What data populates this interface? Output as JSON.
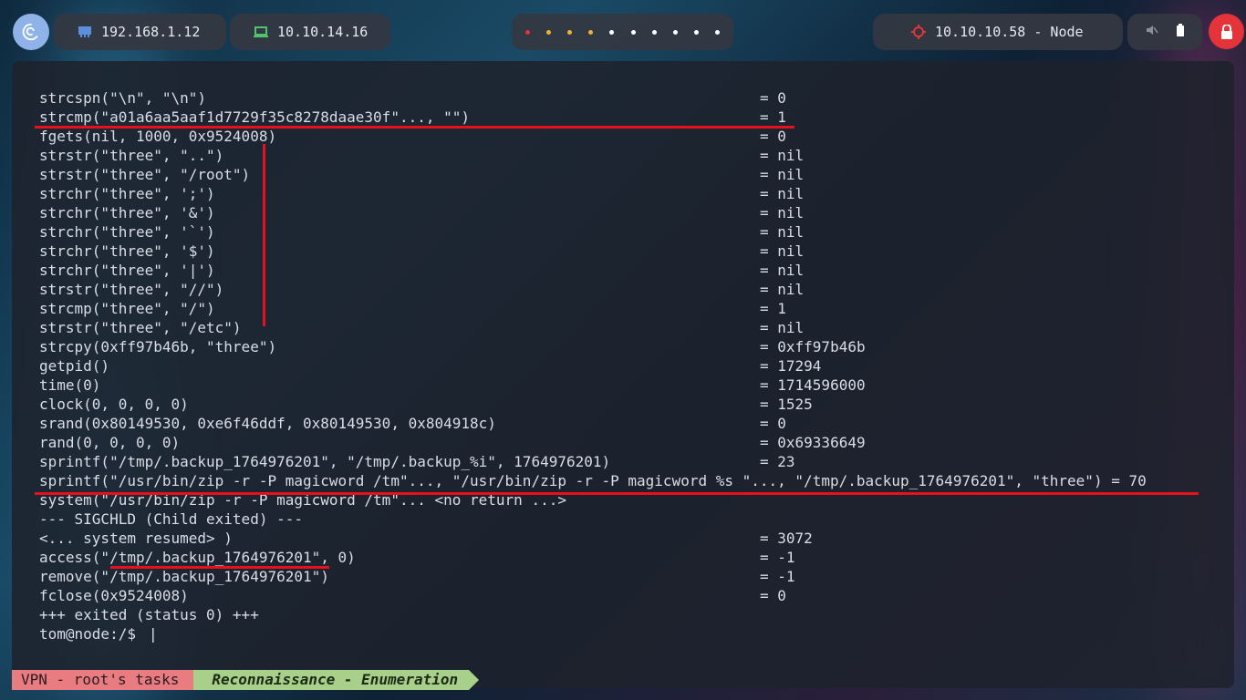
{
  "topbar": {
    "local_ip": "192.168.1.12",
    "vpn_ip": "10.10.14.16",
    "target": "10.10.10.58 - Node",
    "workspace_dots": [
      {
        "color": "#e5333a"
      },
      {
        "color": "#f0b232"
      },
      {
        "color": "#f0b232"
      },
      {
        "color": "#f0b232"
      },
      {
        "color": "#ffffff"
      },
      {
        "color": "#ffffff"
      },
      {
        "color": "#ffffff"
      },
      {
        "color": "#ffffff"
      },
      {
        "color": "#ffffff"
      },
      {
        "color": "#ffffff"
      }
    ],
    "icons": [
      "debian-logo-icon",
      "network-icon",
      "laptop-icon",
      "target-icon",
      "mute-icon",
      "battery-icon",
      "lock-icon"
    ]
  },
  "terminal": {
    "lines": [
      {
        "call": "strcspn(\"\\n\", \"\\n\")",
        "ret": "= 0"
      },
      {
        "call": "strcmp(\"a01a6aa5aaf1d7729f35c8278daae30f\"..., \"\")",
        "ret": "= 1"
      },
      {
        "call": "fgets(nil, 1000, 0x9524008)",
        "ret": "= 0"
      },
      {
        "call": "strstr(\"three\", \"..\")",
        "ret": "= nil"
      },
      {
        "call": "strstr(\"three\", \"/root\")",
        "ret": "= nil"
      },
      {
        "call": "strchr(\"three\", ';')",
        "ret": "= nil"
      },
      {
        "call": "strchr(\"three\", '&')",
        "ret": "= nil"
      },
      {
        "call": "strchr(\"three\", '`')",
        "ret": "= nil"
      },
      {
        "call": "strchr(\"three\", '$')",
        "ret": "= nil"
      },
      {
        "call": "strchr(\"three\", '|')",
        "ret": "= nil"
      },
      {
        "call": "strstr(\"three\", \"//\")",
        "ret": "= nil"
      },
      {
        "call": "strcmp(\"three\", \"/\")",
        "ret": "= 1"
      },
      {
        "call": "strstr(\"three\", \"/etc\")",
        "ret": "= nil"
      },
      {
        "call": "strcpy(0xff97b46b, \"three\")",
        "ret": "= 0xff97b46b"
      },
      {
        "call": "getpid()",
        "ret": "= 17294"
      },
      {
        "call": "time(0)",
        "ret": "= 1714596000"
      },
      {
        "call": "clock(0, 0, 0, 0)",
        "ret": "= 1525"
      },
      {
        "call": "srand(0x80149530, 0xe6f46ddf, 0x80149530, 0x804918c)",
        "ret": "= 0"
      },
      {
        "call": "rand(0, 0, 0, 0)",
        "ret": "= 0x69336649"
      },
      {
        "call": "sprintf(\"/tmp/.backup_1764976201\", \"/tmp/.backup_%i\", 1764976201)",
        "ret": "= 23"
      },
      {
        "call": "sprintf(\"/usr/bin/zip -r -P magicword /tm\"..., \"/usr/bin/zip -r -P magicword %s \"..., \"/tmp/.backup_1764976201\", \"three\") = 70",
        "ret": ""
      },
      {
        "call": "system(\"/usr/bin/zip -r -P magicword /tm\"... <no return ...>",
        "ret": ""
      },
      {
        "call": "--- SIGCHLD (Child exited) ---",
        "ret": ""
      },
      {
        "call": "<... system resumed> )",
        "ret": "= 3072"
      },
      {
        "call": "access(\"/tmp/.backup_1764976201\", 0)",
        "ret": "= -1"
      },
      {
        "call": "remove(\"/tmp/.backup_1764976201\")",
        "ret": "= -1"
      },
      {
        "call": "fclose(0x9524008)",
        "ret": "= 0"
      },
      {
        "call": "+++ exited (status 0) +++",
        "ret": ""
      },
      {
        "call": "tom@node:/$ ",
        "ret": ""
      }
    ],
    "cursor": "|"
  },
  "statusbar": {
    "segment1": "VPN - root's tasks",
    "segment2": "Reconnaissance - Enumeration"
  }
}
